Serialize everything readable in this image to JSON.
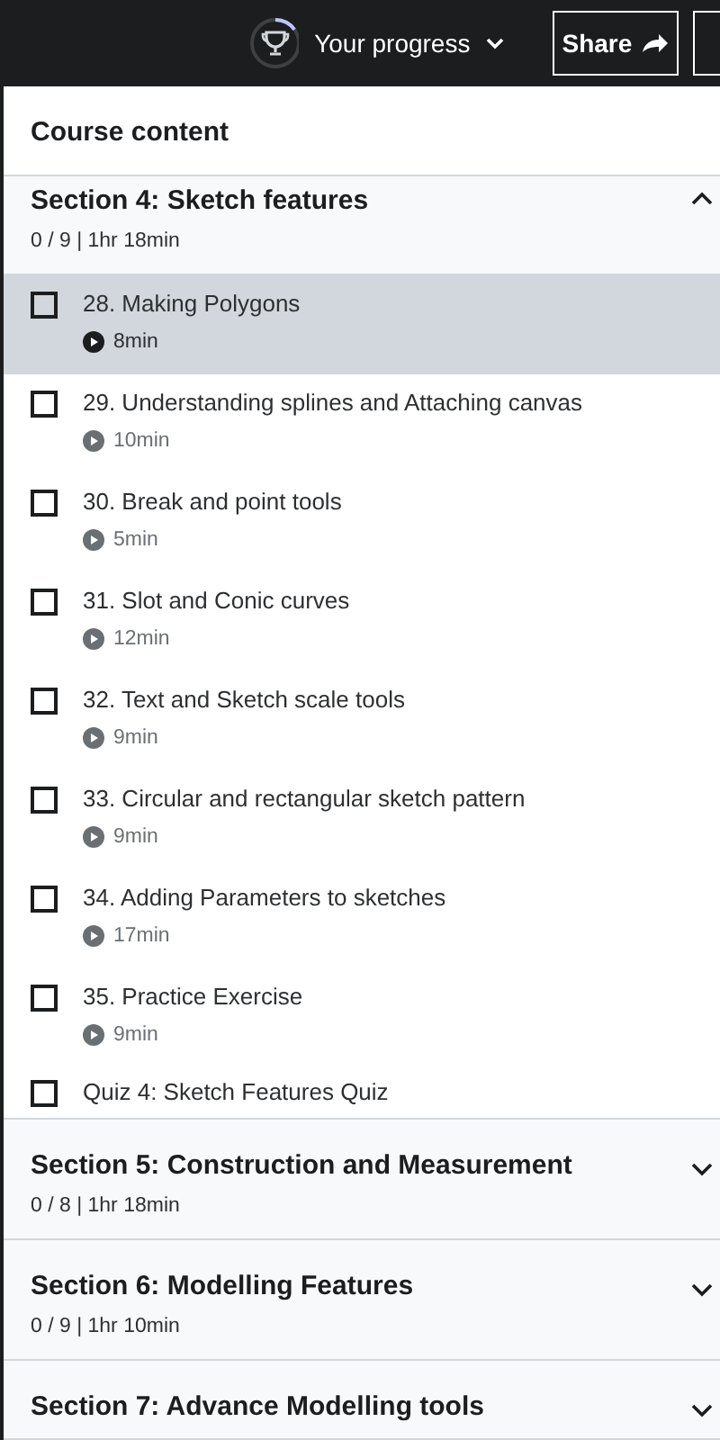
{
  "header": {
    "progress": {
      "label": "Your progress",
      "level": 0.15
    },
    "share_button": "Share"
  },
  "course_content": {
    "title": "Course content"
  },
  "sections": [
    {
      "title": "Section 4: Sketch features",
      "meta": "0 / 9 | 1hr 18min",
      "expanded": true,
      "items": [
        {
          "kind": "video",
          "title": "28. Making Polygons",
          "duration": "8min",
          "selected": true,
          "checked": false
        },
        {
          "kind": "video",
          "title": "29. Understanding splines and Attaching canvas",
          "duration": "10min",
          "selected": false,
          "checked": false
        },
        {
          "kind": "video",
          "title": "30. Break and point tools",
          "duration": "5min",
          "selected": false,
          "checked": false
        },
        {
          "kind": "video",
          "title": "31. Slot and Conic curves",
          "duration": "12min",
          "selected": false,
          "checked": false
        },
        {
          "kind": "video",
          "title": "32. Text and Sketch scale tools",
          "duration": "9min",
          "selected": false,
          "checked": false
        },
        {
          "kind": "video",
          "title": "33. Circular and rectangular sketch pattern",
          "duration": "9min",
          "selected": false,
          "checked": false
        },
        {
          "kind": "video",
          "title": "34. Adding Parameters to sketches",
          "duration": "17min",
          "selected": false,
          "checked": false
        },
        {
          "kind": "video",
          "title": "35. Practice Exercise",
          "duration": "9min",
          "selected": false,
          "checked": false
        },
        {
          "kind": "quiz",
          "title": "Quiz 4: Sketch Features Quiz",
          "selected": false,
          "checked": false
        }
      ]
    },
    {
      "title": "Section 5: Construction and Measurement",
      "meta": "0 / 8 | 1hr 18min",
      "expanded": false
    },
    {
      "title": "Section 6: Modelling Features",
      "meta": "0 / 9 | 1hr 10min",
      "expanded": false
    },
    {
      "title": "Section 7: Advance Modelling tools",
      "expanded": false
    }
  ]
}
